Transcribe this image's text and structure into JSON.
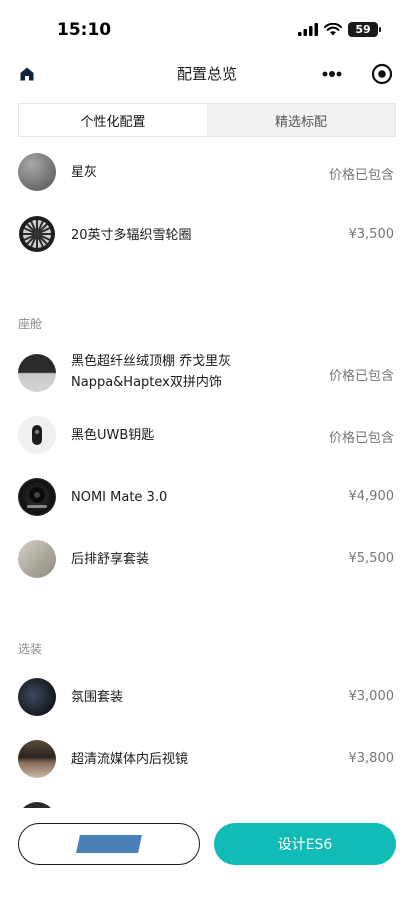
{
  "status_bar": {
    "time": "15:10",
    "battery": "59"
  },
  "nav": {
    "title": "配置总览"
  },
  "tabs": [
    {
      "label": "个性化配置",
      "active": true
    },
    {
      "label": "精选标配",
      "active": false
    }
  ],
  "sections": {
    "exterior": {
      "items": [
        {
          "name": "星灰",
          "price": "价格已包含",
          "icon": "grey-paint-swatch"
        },
        {
          "name": "20英寸多辐织雪轮圈",
          "price": "¥3,500",
          "icon": "wheel-image"
        }
      ]
    },
    "cabin": {
      "title": "座舱",
      "items": [
        {
          "name_line1": "黑色超纤丝绒顶棚 乔戈里灰",
          "name_line2": "Nappa&Haptex双拼内饰",
          "price": "价格已包含",
          "icon": "interior-swatch"
        },
        {
          "name": "黑色UWB钥匙",
          "price": "价格已包含",
          "icon": "key-image"
        },
        {
          "name": "NOMI Mate 3.0",
          "price": "¥4,900",
          "icon": "nomi-image"
        },
        {
          "name": "后排舒享套装",
          "price": "¥5,500",
          "icon": "rear-seat-image"
        }
      ]
    },
    "options": {
      "title": "选装",
      "items": [
        {
          "name": "氛围套装",
          "price": "¥3,000",
          "icon": "ambient-image"
        },
        {
          "name": "超清流媒体内后视镜",
          "price": "¥3,800",
          "icon": "mirror-image"
        }
      ]
    }
  },
  "buttons": {
    "primary": "设计ES6"
  },
  "colors": {
    "accent": "#12bcb6"
  }
}
